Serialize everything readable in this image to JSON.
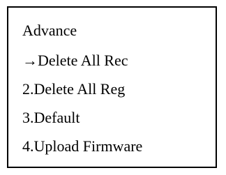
{
  "menu": {
    "title": "Advance",
    "items": [
      {
        "label": "→Delete All Rec"
      },
      {
        "label": "2.Delete All Reg"
      },
      {
        "label": "3.Default"
      },
      {
        "label": "4.Upload Firmware"
      }
    ]
  }
}
